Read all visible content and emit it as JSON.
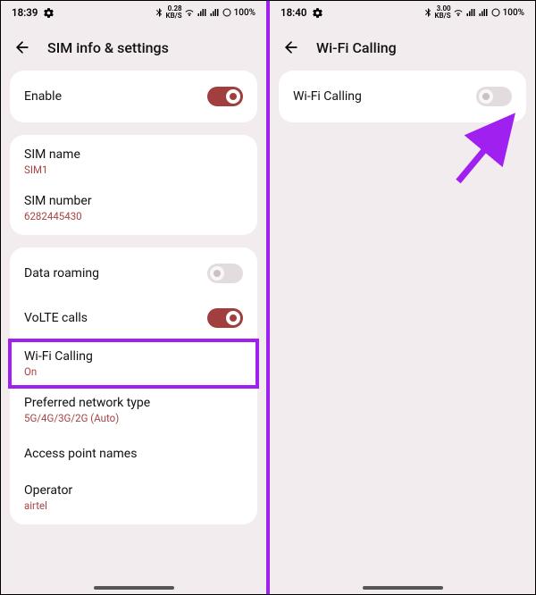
{
  "left": {
    "status": {
      "time": "18:39",
      "rate_top": "0.28",
      "rate_bottom": "KB/S",
      "battery": "100%"
    },
    "header": {
      "title": "SIM info & settings"
    },
    "enable": {
      "label": "Enable"
    },
    "sim": {
      "name_label": "SIM name",
      "name_value": "SIM1",
      "number_label": "SIM number",
      "number_value": "6282445430"
    },
    "net": {
      "roaming_label": "Data roaming",
      "volte_label": "VoLTE calls",
      "wifi_calling_label": "Wi-Fi Calling",
      "wifi_calling_value": "On",
      "pref_net_label": "Preferred network type",
      "pref_net_value": "5G/4G/3G/2G (Auto)",
      "apn_label": "Access point names",
      "operator_label": "Operator",
      "operator_value": "airtel"
    }
  },
  "right": {
    "status": {
      "time": "18:40",
      "rate_top": "3.00",
      "rate_bottom": "KB/S",
      "battery": "100%"
    },
    "header": {
      "title": "Wi-Fi Calling"
    },
    "toggle": {
      "label": "Wi-Fi Calling"
    }
  }
}
